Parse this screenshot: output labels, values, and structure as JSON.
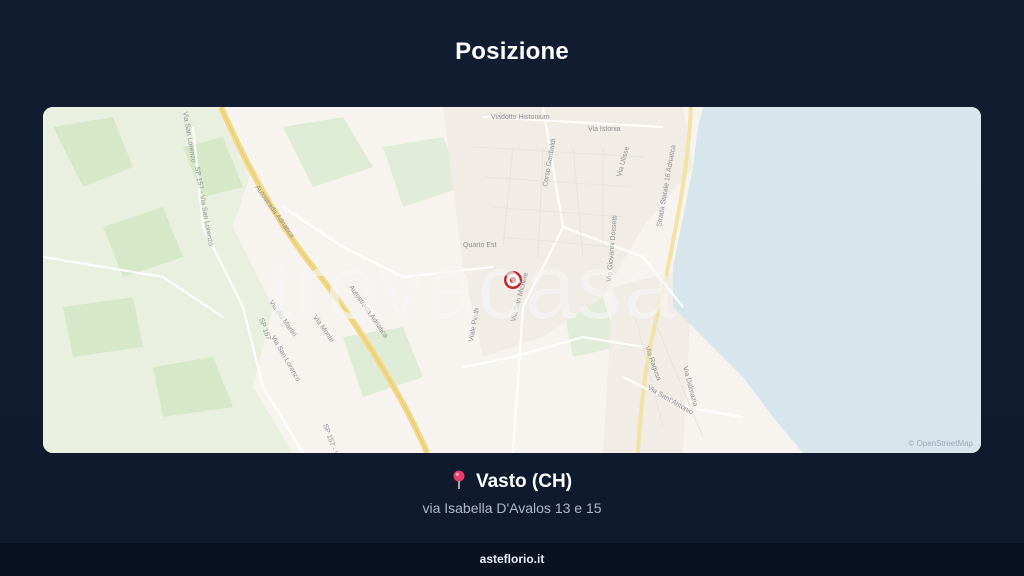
{
  "header": {
    "title": "Posizione"
  },
  "map": {
    "watermark": "trovacasa",
    "attribution": "© OpenStreetMap",
    "marker_icon": "location-marker-icon",
    "street_labels": {
      "viadotto": "Viadotto Histonium",
      "via_istonia": "Via Istonia",
      "corso_garibaldi": "Corso Garibaldi",
      "via_ulisse": "Via Ulisse",
      "strada_statale": "Strada Statale 16 Adriatica",
      "sp157_a": "SP 157 - Via San Lorenzo",
      "via_san_lorenzo": "Via San Lorenzo",
      "autostrada_a": "Autostrada Adriatica",
      "autostrada_b": "Autostrada Adriatica",
      "viale_perth": "Viale Perth",
      "via_san_michele": "Via San Michele",
      "via_giovanni_dossetti": "Via Giovanni Dossetti",
      "via_ragusa": "Via Ragusa",
      "via_sant_antonio": "Via Sant'Antonio",
      "via_san_lorenzo_b": "Via San Lorenzo",
      "sp157_b": "SP 157",
      "sp157_c": "SP 157 - Via",
      "via_dalmazia": "Via Dalmazia",
      "via_martiri": "Via dei Martiri",
      "via_monte": "Via Monte",
      "quarto": "Quarto Est"
    }
  },
  "location": {
    "pin_icon": "pushpin-icon",
    "city": "Vasto (CH)",
    "address": "via Isabella D'Avalos 13 e 15"
  },
  "footer": {
    "brand": "asteflorio.it"
  },
  "colors": {
    "background": "#111c31",
    "sea": "#d7e6ed",
    "land": "#f6f3ee",
    "green": "#dcecd2",
    "motorway": "#f2d98a",
    "marker": "#c0282f"
  }
}
